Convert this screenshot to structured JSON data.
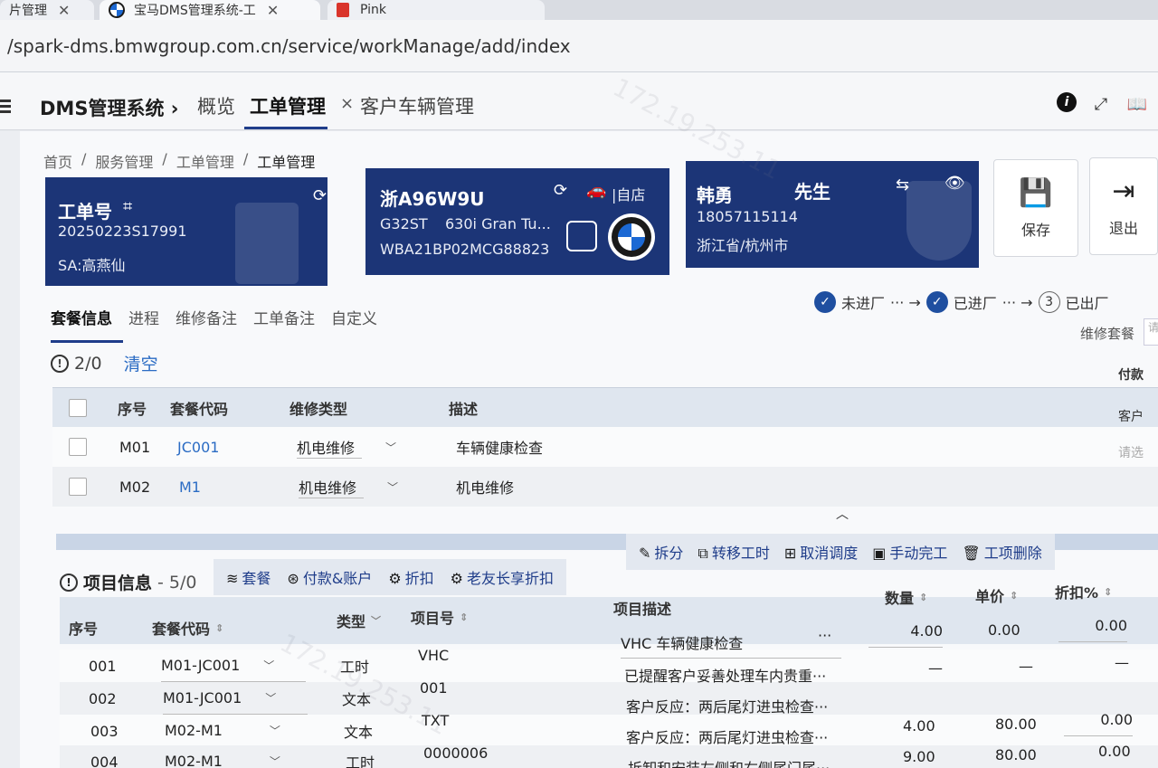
{
  "browser": {
    "tabs": [
      {
        "title": "片管理",
        "close": "✕"
      },
      {
        "title": "宝马DMS管理系统-工",
        "close": "✕"
      },
      {
        "title": "Pink",
        "close": ""
      }
    ],
    "url": "/spark-dms.bmwgroup.com.cn/service/workManage/add/index"
  },
  "header": {
    "system_title": "DMS管理系统 ›",
    "tabs": [
      "概览",
      "工单管理",
      "客户车辆管理"
    ],
    "close_glyph": "×",
    "icons": [
      "info-icon",
      "fullscreen-icon",
      "book-icon"
    ]
  },
  "breadcrumb": [
    "首页",
    "/",
    "服务管理",
    "/",
    "工单管理",
    "/",
    "工单管理"
  ],
  "order_card": {
    "label": "工单号",
    "number": "20250223S17991",
    "sa": "SA:高燕仙"
  },
  "vehicle_card": {
    "plate": "浙A96W9U",
    "model_code": "G32ST",
    "model_name": "630i Gran Tu...",
    "vin": "WBA21BP02MCG88823",
    "store_label": "|自店"
  },
  "customer_card": {
    "name": "韩勇",
    "title": "先生",
    "phone": "18057115114",
    "region": "浙江省/杭州市"
  },
  "actions": {
    "save": "保存",
    "exit": "退出"
  },
  "section_tabs": [
    "套餐信息",
    "进程",
    "维修备注",
    "工单备注",
    "自定义"
  ],
  "progress": {
    "step1": "未进厂",
    "step2": "已进厂",
    "step3_num": "3",
    "step3": "已出厂",
    "arrow": "··· →"
  },
  "package_select_label": "维修套餐",
  "package_select_placeholder": "请",
  "package_count": "2/0",
  "clear_label": "清空",
  "package_table": {
    "headers": [
      "序号",
      "套餐代码",
      "维修类型",
      "描述"
    ],
    "side_header": "付款",
    "rows": [
      {
        "no": "M01",
        "code": "JC001",
        "type": "机电维修",
        "desc": "车辆健康检查",
        "side": "客户"
      },
      {
        "no": "M02",
        "code": "M1",
        "type": "机电维修",
        "desc": "机电维修",
        "side": "请选"
      }
    ]
  },
  "project": {
    "title": "项目信息",
    "count": "- 5/0",
    "toolbar_left": [
      "套餐",
      "付款&账户",
      "折扣",
      "老友长享折扣"
    ],
    "toolbar_right": [
      "拆分",
      "转移工时",
      "取消调度",
      "手动完工",
      "工项删除"
    ],
    "headers": [
      "序号",
      "套餐代码",
      "类型",
      "项目号",
      "项目描述",
      "数量",
      "单价",
      "折扣%"
    ],
    "rows": [
      {
        "no": "001",
        "pkg": "M01-JC001",
        "type": "工时",
        "item": "VHC",
        "desc": "VHC 车辆健康检查",
        "more": "···",
        "qty": "4.00",
        "price": "0.00",
        "disc": "0.00"
      },
      {
        "no": "002",
        "pkg": "M01-JC001",
        "type": "文本",
        "item": "001",
        "desc": "已提醒客户妥善处理车内贵重···",
        "more": "",
        "qty": "—",
        "price": "—",
        "disc": "—"
      },
      {
        "no": "003",
        "pkg": "M02-M1",
        "type": "文本",
        "item": "TXT",
        "desc": "客户反应：两后尾灯进虫检查···",
        "more": "",
        "qty": "—",
        "price": "—",
        "disc": "—"
      },
      {
        "no": "003",
        "pkg": "M02-M1",
        "type": "文本",
        "item": "TXT",
        "desc": "客户反应：两后尾灯进虫检查···",
        "more": "",
        "qty": "4.00",
        "price": "80.00",
        "disc": "0.00"
      },
      {
        "no": "004",
        "pkg": "M02-M1",
        "type": "工时",
        "item": "0000006",
        "desc": "拆卸和安装左侧和右侧尾门尾···",
        "more": "",
        "qty": "9.00",
        "price": "80.00",
        "disc": "0.00"
      }
    ]
  },
  "watermark": "172.19.253.11"
}
